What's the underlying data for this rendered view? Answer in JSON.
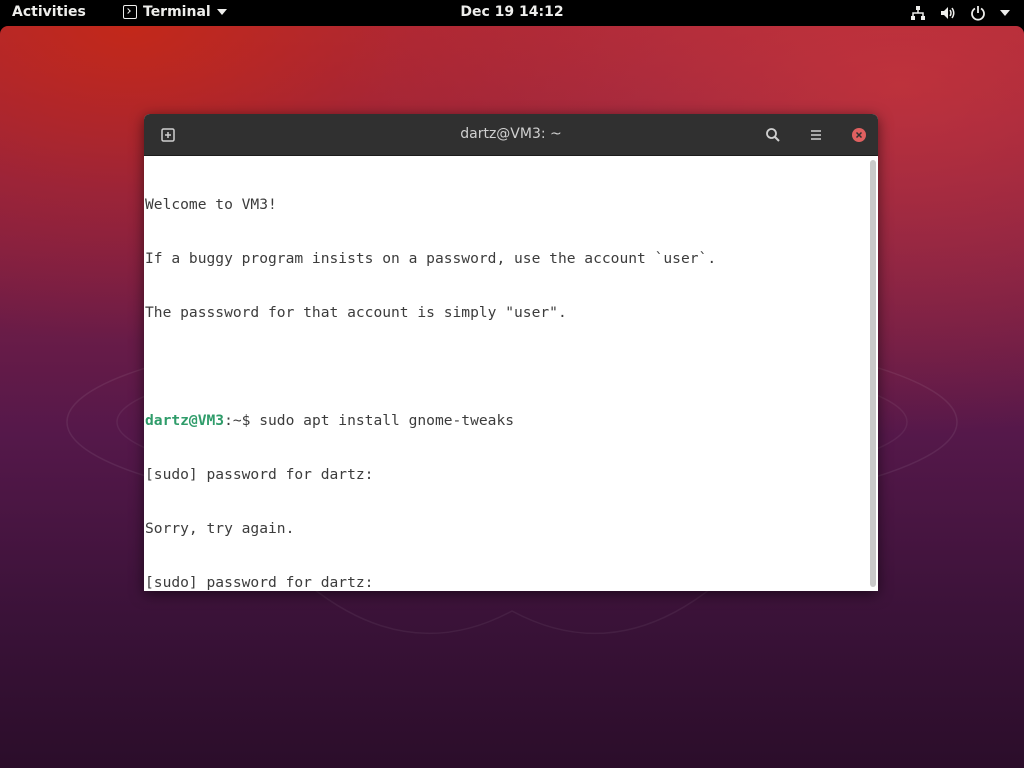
{
  "topbar": {
    "activities": "Activities",
    "app_name": "Terminal",
    "datetime": "Dec 19  14:12",
    "icons": [
      "network-icon",
      "volume-icon",
      "power-icon",
      "chevron-down-icon"
    ]
  },
  "window": {
    "title": "dartz@VM3: ~",
    "buttons": [
      "new-tab-icon",
      "search-icon",
      "hamburger-menu-icon",
      "close-icon"
    ]
  },
  "terminal": {
    "lines": [
      "Welcome to VM3!",
      "If a buggy program insists on a password, use the account `user`.",
      "The passsword for that account is simply \"user\".",
      ""
    ],
    "prompt_user_host": "dartz@VM3",
    "prompt_path": ":~$",
    "command": " sudo apt install gnome-tweaks",
    "output": [
      "[sudo] password for dartz:",
      "Sorry, try again.",
      "[sudo] password for dartz:"
    ]
  },
  "colors": {
    "prompt_green": "#2f9c6a",
    "close_red": "#e06060",
    "headerbar": "#303030"
  }
}
